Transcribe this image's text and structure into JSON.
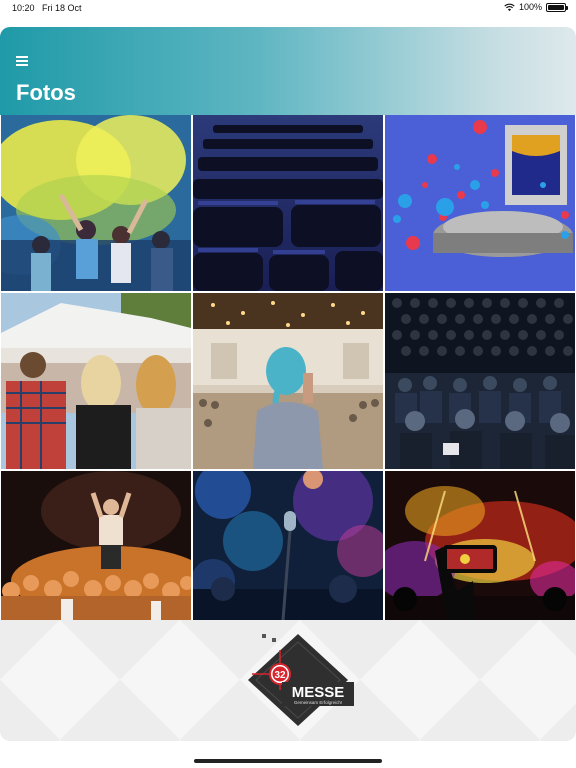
{
  "status_bar": {
    "time": "10:20",
    "date": "Fri 18 Oct",
    "battery": "100%"
  },
  "header": {
    "title": "Fotos",
    "menu_icon": "hamburger-menu-icon"
  },
  "photos": [
    {
      "subject": "color-powder-festival-photo"
    },
    {
      "subject": "empty-chairs-hall-photo"
    },
    {
      "subject": "virtual-stage-likes-photo"
    },
    {
      "subject": "festival-crowd-tent-photo"
    },
    {
      "subject": "woman-on-phone-in-hall-photo"
    },
    {
      "subject": "conference-audience-photo"
    },
    {
      "subject": "performer-and-hands-photo"
    },
    {
      "subject": "microphone-stage-lights-photo"
    },
    {
      "subject": "concert-phone-recording-photo"
    }
  ],
  "logo": {
    "number": "32",
    "word": "MESSE",
    "tagline": "Gemeinsam Erfolgreich!",
    "accent": "#d8242c"
  },
  "colors": {
    "header_start": "#1f9aa8",
    "header_end": "#dfe9ec"
  }
}
